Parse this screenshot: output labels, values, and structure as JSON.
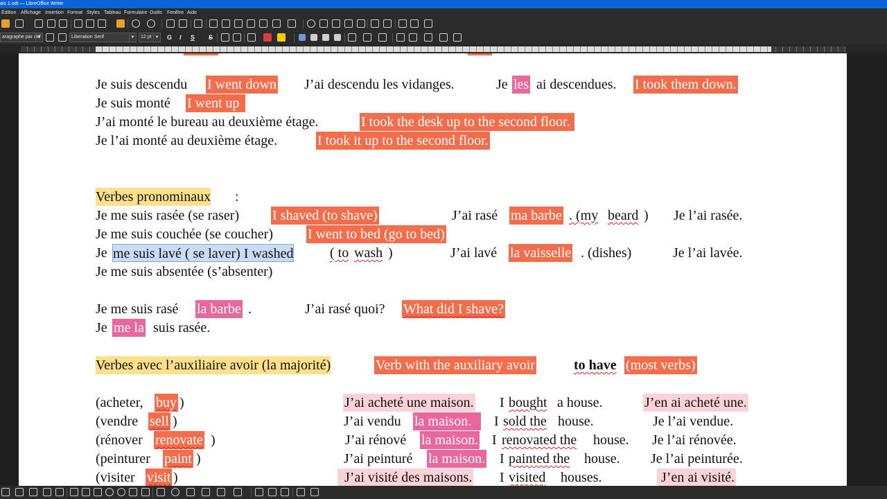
{
  "window": {
    "title": "ais 1.odt — LibreOffice Writer"
  },
  "menu": [
    "Édition",
    "Affichage",
    "Insertion",
    "Format",
    "Styles",
    "Tableau",
    "Formulaire",
    "Outils",
    "Fenêtre",
    "Aide"
  ],
  "format_toolbar": {
    "paragraph_style": "aragraphe par déf",
    "font_name": "Liberation Serif",
    "font_size": "12 pt",
    "bold": "G",
    "italic": "I",
    "underline": "S",
    "strike": "S"
  },
  "doc": {
    "l1": {
      "a": "Je suis descendu",
      "b": "I went down",
      "c": "J’ai descendu les vidanges.",
      "d": "Je",
      "e": "les",
      "f": "ai descendues.",
      "g": "I took them down."
    },
    "l2": {
      "a": "Je suis monté",
      "b": "I went up"
    },
    "l3": {
      "a": "J’ai monté le bureau au deuxième étage.",
      "b": "I took the desk up to the second floor."
    },
    "l4": {
      "a": "Je l’ai monté au deuxième étage.",
      "b": "I took it up to the second floor."
    },
    "l5": {
      "a": "Verbes pronominaux",
      "b": ":"
    },
    "l6": {
      "a": "Je me suis rasée (se raser)",
      "b": "I shaved (to shave)",
      "c": "J’ai rasé",
      "d": "ma barbe",
      "e": ". (my",
      "f": "beard",
      "g": ")",
      "h": "Je l’ai rasée."
    },
    "l7": {
      "a": "Je me suis couchée (se coucher)",
      "b": "I went to bed (go to bed)"
    },
    "l8": {
      "a": "Je",
      "b": "me suis lavé ( se laver) I washed",
      "c": "( to",
      "d": "wash",
      "e": ")",
      "f": "J’ai lavé",
      "g": "la vaisselle",
      "h": ". (dishes)",
      "i": "Je l’ai lavée."
    },
    "l9": {
      "a": "Je me suis absentée (s’absenter)"
    },
    "l10": {
      "a": "Je me suis rasé",
      "b": "la barbe",
      "c": ".",
      "d": "J’ai rasé quoi?",
      "e": "What did I shave?"
    },
    "l11": {
      "a": "Je",
      "b": "me la",
      "c": "suis rasée."
    },
    "l12": {
      "a": "Verbes avec l’auxiliaire avoir (la majorité)",
      "b": "Verb with the auxiliary   avoir",
      "c": "to have",
      "d": "(most verbs)"
    },
    "l13": {
      "a": "(acheter,",
      "b": "buy",
      "c": ")",
      "d": "J’ai acheté une maison.",
      "e": "I",
      "f": "bought",
      "g": "a house.",
      "h": "J’en ai acheté une."
    },
    "l14": {
      "a": "(vendre",
      "b": "sell",
      "c": ")",
      "d": "J’ai vendu",
      "e": "la maison.",
      "f": "I",
      "g": "sold the",
      "h": "house.",
      "i": "Je l’ai vendue."
    },
    "l15": {
      "a": "(rénover",
      "b": "renovate",
      "c": ")",
      "d": "J’ai rénové",
      "e": "la maison.",
      "f": "I",
      "g": "renovated the",
      "h": "house.",
      "i": "Je l’ai rénovée."
    },
    "l16": {
      "a": "(peinturer",
      "b": "paint",
      "c": ")",
      "d": "J’ai peinturé",
      "e": "la maison.",
      "f": "I",
      "g": "painted the",
      "h": "house.",
      "i": "Je l’ai  peinturée."
    },
    "l17": {
      "a": "(visiter",
      "b": "visit",
      "c": ")",
      "d": "J’ai visité des maisons.",
      "e": "I",
      "f": "visited",
      "g": "houses.",
      "h": "J’en ai visité."
    }
  },
  "colors": {
    "orange_highlight": "#f26d4b",
    "pink_highlight": "#e8679c",
    "light_pink": "#f9d3d8",
    "yellow_highlight": "#fde08a",
    "title_bar": "#0a64d8"
  }
}
